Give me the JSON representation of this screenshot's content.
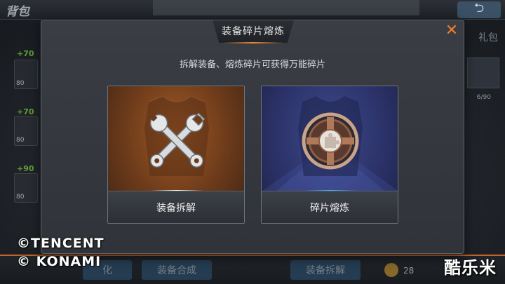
{
  "background": {
    "screen_title": "背包",
    "left_items": [
      {
        "tag": "+70",
        "level": "80"
      },
      {
        "tag": "+70",
        "level": "80"
      },
      {
        "tag": "+90",
        "level": "80"
      }
    ],
    "right_label": "礼包",
    "right_count": "6/90",
    "bottom_buttons": [
      "化",
      "装备合成",
      "装备拆解"
    ],
    "bottom_count": "28"
  },
  "dialog": {
    "title": "装备碎片熔炼",
    "close_glyph": "✕",
    "subtitle": "拆解装备、熔炼碎片可获得万能碎片",
    "options": [
      {
        "label": "装备拆解",
        "icon": "crossed-wrenches-icon",
        "theme_color": "#8a4a1f"
      },
      {
        "label": "碎片熔炼",
        "icon": "fragment-furnace-icon",
        "theme_color": "#333b7a"
      }
    ]
  },
  "watermarks": {
    "copyright_lines": [
      "©TENCENT",
      "© KONAMI"
    ],
    "site_logo": "酷乐米"
  },
  "colors": {
    "accent_orange": "#f07f28",
    "dialog_bg": "#363a40"
  }
}
